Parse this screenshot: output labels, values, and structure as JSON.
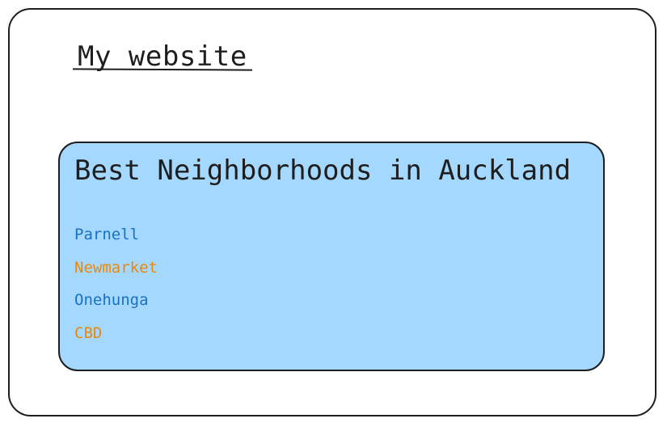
{
  "site": {
    "title": "My website"
  },
  "card": {
    "title": "Best Neighborhoods in Auckland",
    "items": [
      {
        "label": "Parnell",
        "color": "#1971c2"
      },
      {
        "label": "Newmarket",
        "color": "#e8890c"
      },
      {
        "label": "Onehunga",
        "color": "#1971c2"
      },
      {
        "label": "CBD",
        "color": "#e8890c"
      }
    ]
  },
  "colors": {
    "card_background": "#a5d8ff",
    "stroke": "#1e1e1e",
    "link_blue": "#1971c2",
    "link_orange": "#e8890c"
  }
}
